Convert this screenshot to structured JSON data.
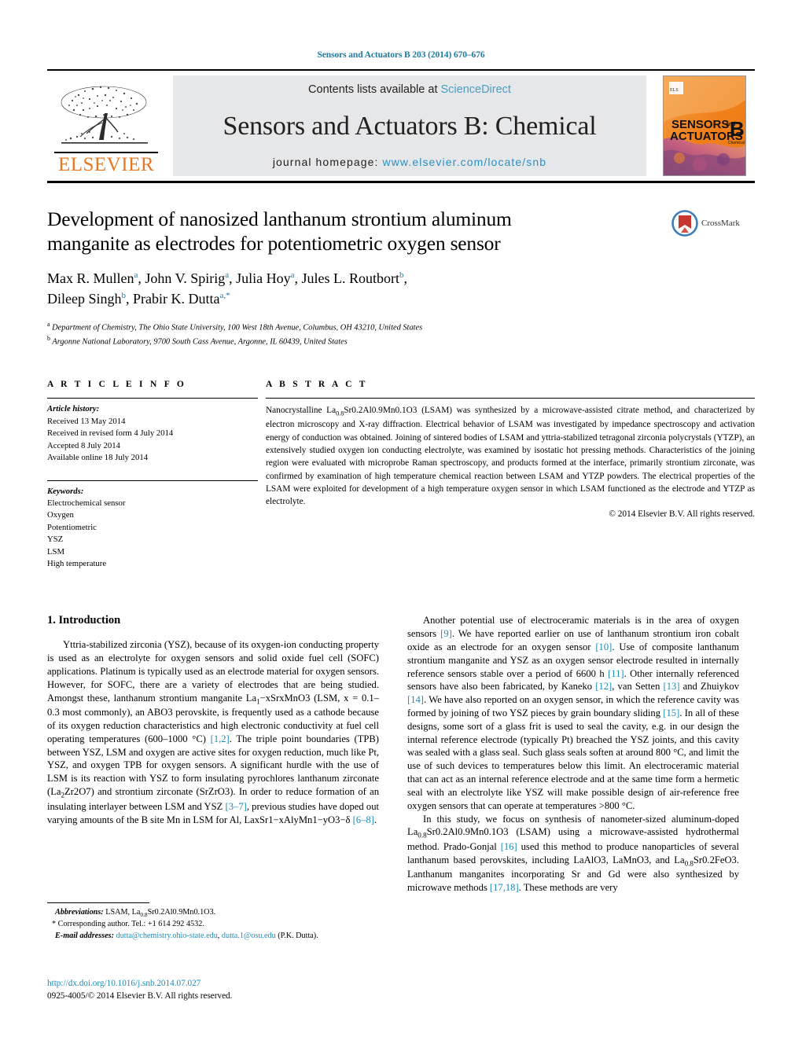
{
  "running_head": "Sensors and Actuators B 203 (2014) 670–676",
  "masthead": {
    "publisher_name": "ELSEVIER",
    "contents_prefix": "Contents lists available at ",
    "contents_link": "ScienceDirect",
    "journal_title": "Sensors and Actuators B: Chemical",
    "homepage_prefix": "journal homepage: ",
    "homepage_url": "www.elsevier.com/locate/snb",
    "cover_line1": "SENSORS",
    "cover_and": "and",
    "cover_line2": "ACTUATORS",
    "cover_letter": "B",
    "cover_sub": "Chemical",
    "accent_orange": "#e87722",
    "link_blue": "#2b8fc4"
  },
  "crossmark": {
    "label": "CrossMark"
  },
  "article": {
    "title": "Development of nanosized lanthanum strontium aluminum manganite as electrodes for potentiometric oxygen sensor",
    "authors_line1": "Max R. Mullen",
    "authors": [
      {
        "name": "Max R. Mullen",
        "sup": "a",
        "sep": ", "
      },
      {
        "name": "John V. Spirig",
        "sup": "a",
        "sep": ", "
      },
      {
        "name": "Julia Hoy",
        "sup": "a",
        "sep": ", "
      },
      {
        "name": "Jules L. Routbort",
        "sup": "b",
        "sep": ","
      },
      {
        "name": "Dileep Singh",
        "sup": "b",
        "sep": ", "
      },
      {
        "name": "Prabir K. Dutta",
        "sup": "a,*",
        "sep": ""
      }
    ],
    "affiliations": [
      {
        "marker": "a",
        "text": "Department of Chemistry, The Ohio State University, 100 West 18th Avenue, Columbus, OH 43210, United States"
      },
      {
        "marker": "b",
        "text": "Argonne National Laboratory, 9700 South Cass Avenue, Argonne, IL 60439, United States"
      }
    ]
  },
  "article_info": {
    "heading": "A R T I C L E    I N F O",
    "history_label": "Article history:",
    "history": [
      "Received 13 May 2014",
      "Received in revised form 4 July 2014",
      "Accepted 8 July 2014",
      "Available online 18 July 2014"
    ],
    "keywords_label": "Keywords:",
    "keywords": [
      "Electrochemical sensor",
      "Oxygen",
      "Potentiometric",
      "YSZ",
      "LSM",
      "High temperature"
    ]
  },
  "abstract": {
    "heading": "A B S T R A C T",
    "text": "Nanocrystalline La0.8Sr0.2Al0.9Mn0.1O3 (LSAM) was synthesized by a microwave-assisted citrate method, and characterized by electron microscopy and X-ray diffraction. Electrical behavior of LSAM was investigated by impedance spectroscopy and activation energy of conduction was obtained. Joining of sintered bodies of LSAM and yttria-stabilized tetragonal zirconia polycrystals (YTZP), an extensively studied oxygen ion conducting electrolyte, was examined by isostatic hot pressing methods. Characteristics of the joining region were evaluated with microprobe Raman spectroscopy, and products formed at the interface, primarily strontium zirconate, was confirmed by examination of high temperature chemical reaction between LSAM and YTZP powders. The electrical properties of the LSAM were exploited for development of a high temperature oxygen sensor in which LSAM functioned as the electrode and YTZP as electrolyte.",
    "copyright": "© 2014 Elsevier B.V. All rights reserved."
  },
  "introduction": {
    "number_title": "1.  Introduction",
    "left_p1": "Yttria-stabilized zirconia (YSZ), because of its oxygen-ion conducting property is used as an electrolyte for oxygen sensors and solid oxide fuel cell (SOFC) applications. Platinum is typically used as an electrode material for oxygen sensors. However, for SOFC, there are a variety of electrodes that are being studied. Amongst these, lanthanum strontium manganite La1−xSrxMnO3 (LSM, x = 0.1–0.3 most commonly), an ABO3 perovskite, is frequently used as a cathode because of its oxygen reduction characteristics and high electronic conductivity at fuel cell operating temperatures (600–1000 °C) [1,2]. The triple point boundaries (TPB) between YSZ, LSM and oxygen are active sites for oxygen reduction, much like Pt, YSZ, and oxygen TPB for oxygen sensors. A significant hurdle with the use of LSM is its reaction with YSZ to form insulating pyrochlores lanthanum zirconate (La2Zr2O7) and strontium zirconate (SrZrO3). In order to reduce formation of an insulating interlayer between LSM and YSZ [3–7], previous studies have doped out varying amounts of the B site Mn in LSM for Al, LaxSr1−xAlyMn1−yO3−δ [6–8].",
    "right_p1": "Another potential use of electroceramic materials is in the area of oxygen sensors [9]. We have reported earlier on use of lanthanum strontium iron cobalt oxide as an electrode for an oxygen sensor [10]. Use of composite lanthanum strontium manganite and YSZ as an oxygen sensor electrode resulted in internally reference sensors stable over a period of 6600 h [11]. Other internally referenced sensors have also been fabricated, by Kaneko [12], van Setten [13] and Zhuiykov [14]. We have also reported on an oxygen sensor, in which the reference cavity was formed by joining of two YSZ pieces by grain boundary sliding [15]. In all of these designs, some sort of a glass frit is used to seal the cavity, e.g. in our design the internal reference electrode (typically Pt) breached the YSZ joints, and this cavity was sealed with a glass seal. Such glass seals soften at around 800 °C, and limit the use of such devices to temperatures below this limit. An electroceramic material that can act as an internal reference electrode and at the same time form a hermetic seal with an electrolyte like YSZ will make possible design of air-reference free oxygen sensors that can operate at temperatures >800 °C.",
    "right_p2": "In this study, we focus on synthesis of nanometer-sized aluminum-doped La0.8Sr0.2Al0.9Mn0.1O3 (LSAM) using a microwave-assisted hydrothermal method. Prado-Gonjal [16] used this method to produce nanoparticles of several lanthanum based perovskites, including LaAlO3, LaMnO3, and La0.8Sr0.2FeO3. Lanthanum manganites incorporating Sr and Gd were also synthesized by microwave methods [17,18]. These methods are very"
  },
  "footnotes": {
    "abbrev_label": "Abbreviations:",
    "abbrev_text": "LSAM, La0.8Sr0.2Al0.9Mn0.1O3.",
    "corresponding": "Corresponding author. Tel.: +1 614 292 4532.",
    "email_label": "E-mail addresses:",
    "email1": "dutta@chemistry.ohio-state.edu",
    "email2": "dutta.1@osu.edu",
    "email_suffix": "(P.K. Dutta)."
  },
  "doi": {
    "url": "http://dx.doi.org/10.1016/j.snb.2014.07.027",
    "issn_line": "0925-4005/© 2014 Elsevier B.V. All rights reserved."
  }
}
